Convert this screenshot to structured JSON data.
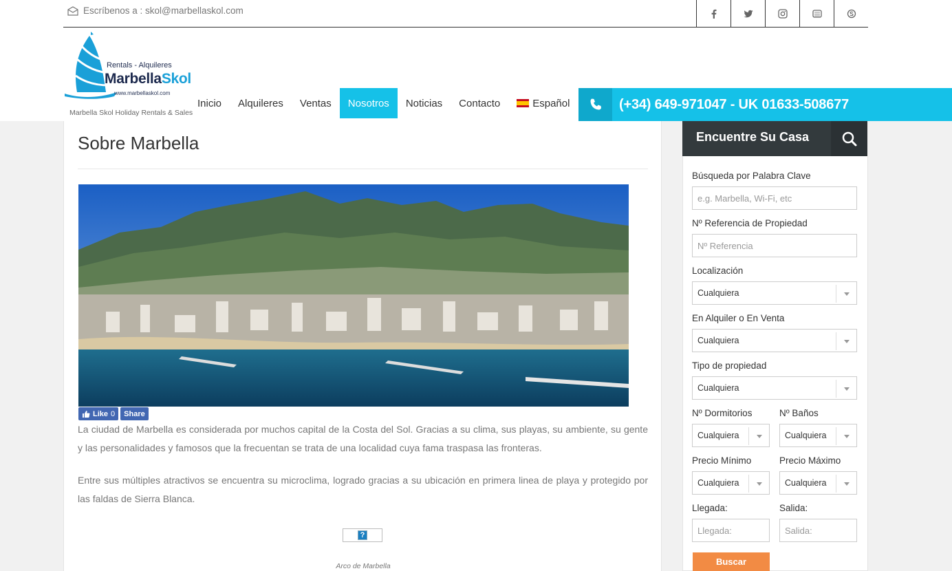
{
  "topbar": {
    "email_text": "Escríbenos a : skol@marbellaskol.com",
    "social_icons": [
      "facebook-icon",
      "twitter-icon",
      "instagram-icon",
      "youtube-icon",
      "skype-icon"
    ]
  },
  "logo": {
    "rentals": "Rentals - Alquileres",
    "brand_part1": "Marbella",
    "brand_part2": "Skol",
    "url": "www.marbellaskol.com",
    "tagline": "Marbella Skol Holiday Rentals & Sales"
  },
  "nav": {
    "items": [
      "Inicio",
      "Alquileres",
      "Ventas",
      "Nosotros",
      "Noticias",
      "Contacto"
    ],
    "active": "Nosotros",
    "language": "Español"
  },
  "phone": {
    "text": "(+34) 649-971047 - UK 01633-508677"
  },
  "article": {
    "title": "Sobre Marbella",
    "fb_like": "Like",
    "fb_count": "0",
    "fb_share": "Share",
    "paragraph1": "La ciudad de Marbella es considerada por muchos capital de la Costa del Sol. Gracias a su clima, sus playas, su ambiente, su gente y las personalidades y famosos que la frecuentan se trata de una localidad cuya fama traspasa las fronteras.",
    "paragraph2": "Entre sus múltiples atractivos se encuentra su microclima, logrado gracias a su ubicación en primera linea de playa y protegido por las faldas de Sierra Blanca.",
    "broken_image_glyph": "?",
    "caption": "Arco de Marbella"
  },
  "search": {
    "title": "Encuentre Su Casa",
    "keyword_label": "Búsqueda por Palabra Clave",
    "keyword_placeholder": "e.g. Marbella, Wi-Fi, etc",
    "ref_label": "Nº Referencia de Propiedad",
    "ref_placeholder": "Nº Referencia",
    "location_label": "Localización",
    "location_value": "Cualquiera",
    "status_label": "En Alquiler o En Venta",
    "status_value": "Cualquiera",
    "type_label": "Tipo de propiedad",
    "type_value": "Cualquiera",
    "bedrooms_label": "Nº Dormitorios",
    "bedrooms_value": "Cualquiera",
    "bathrooms_label": "Nº Baños",
    "bathrooms_value": "Cualquiera",
    "min_price_label": "Precio Mínimo",
    "min_price_value": "Cualquiera",
    "max_price_label": "Precio Máximo",
    "max_price_value": "Cualquiera",
    "arrival_label": "Llegada:",
    "arrival_placeholder": "Llegada:",
    "departure_label": "Salida:",
    "departure_placeholder": "Salida:",
    "submit": "Buscar"
  },
  "colors": {
    "accent": "#15c1e8",
    "search_header": "#333a3d",
    "submit_button": "#f28b44"
  }
}
